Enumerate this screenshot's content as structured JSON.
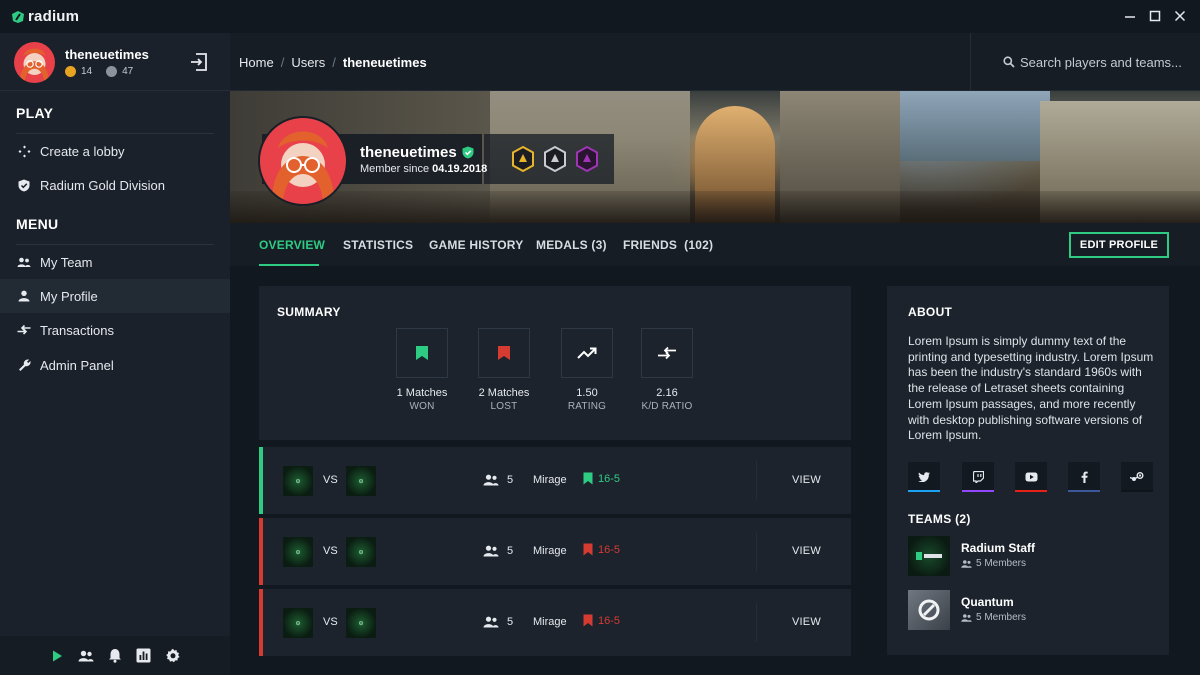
{
  "app": {
    "brand": "radium"
  },
  "user": {
    "name": "theneuetimes",
    "coins_gold": "14",
    "coins_silver": "47"
  },
  "sidebar": {
    "play_title": "PLAY",
    "play_items": [
      {
        "label": "Create a lobby",
        "icon": "gamepad-icon"
      },
      {
        "label": "Radium Gold Division",
        "icon": "shield-icon"
      }
    ],
    "menu_title": "MENU",
    "menu_items": [
      {
        "label": "My Team",
        "icon": "team-icon"
      },
      {
        "label": "My Profile",
        "icon": "person-icon",
        "active": true
      },
      {
        "label": "Transactions",
        "icon": "transfer-icon"
      },
      {
        "label": "Admin Panel",
        "icon": "wrench-icon"
      }
    ],
    "footer_icons": [
      "play-icon",
      "friends-icon",
      "bell-icon",
      "stats-icon",
      "settings-icon"
    ]
  },
  "breadcrumb": {
    "items": [
      "Home",
      "Users"
    ],
    "current": "theneuetimes"
  },
  "search": {
    "placeholder": "Search players and teams..."
  },
  "profile": {
    "name": "theneuetimes",
    "member_since_label": "Member since",
    "member_since": "04.19.2018",
    "medals": [
      "gold-medal",
      "silver-medal",
      "purple-medal"
    ]
  },
  "tabs": [
    {
      "label": "OVERVIEW",
      "active": true
    },
    {
      "label": "STATISTICS"
    },
    {
      "label": "GAME HISTORY"
    },
    {
      "label": "MEDALS (3)"
    },
    {
      "label": "FRIENDS  (102)"
    }
  ],
  "edit_profile": "EDIT PROFILE",
  "summary": {
    "title": "SUMMARY",
    "stats": [
      {
        "value": "1 Matches",
        "label": "WON",
        "icon": "bookmark-green-icon"
      },
      {
        "value": "2 Matches",
        "label": "LOST",
        "icon": "bookmark-red-icon"
      },
      {
        "value": "1.50",
        "label": "RATING",
        "icon": "trend-up-icon"
      },
      {
        "value": "2.16",
        "label": "K/D RATIO",
        "icon": "swap-arrows-icon"
      }
    ]
  },
  "matches": [
    {
      "vs": "VS",
      "players": "5",
      "map": "Mirage",
      "score": "16-5",
      "result": "win",
      "view": "VIEW"
    },
    {
      "vs": "VS",
      "players": "5",
      "map": "Mirage",
      "score": "16-5",
      "result": "loss",
      "view": "VIEW"
    },
    {
      "vs": "VS",
      "players": "5",
      "map": "Mirage",
      "score": "16-5",
      "result": "loss",
      "view": "VIEW"
    }
  ],
  "about": {
    "title": "ABOUT",
    "text": "Lorem Ipsum is simply dummy text of the printing and typesetting industry. Lorem Ipsum has been the industry's standard 1960s with the release of Letraset sheets containing Lorem Ipsum passages, and more recently with desktop publishing software versions of Lorem Ipsum.",
    "socials": [
      {
        "icon": "twitter-icon",
        "color": "#1da1f2"
      },
      {
        "icon": "twitch-icon",
        "color": "#9146ff"
      },
      {
        "icon": "youtube-icon",
        "color": "#e62117"
      },
      {
        "icon": "facebook-icon",
        "color": "#3b5998"
      },
      {
        "icon": "steam-icon",
        "color": "#0f141a"
      }
    ]
  },
  "teams": {
    "title": "TEAMS (2)",
    "items": [
      {
        "name": "Radium Staff",
        "members": "5 Members"
      },
      {
        "name": "Quantum",
        "members": "5 Members"
      }
    ]
  },
  "colors": {
    "accent": "#2ecc83",
    "loss": "#d63b32",
    "bg": "#121820",
    "panel": "#1c232c"
  }
}
